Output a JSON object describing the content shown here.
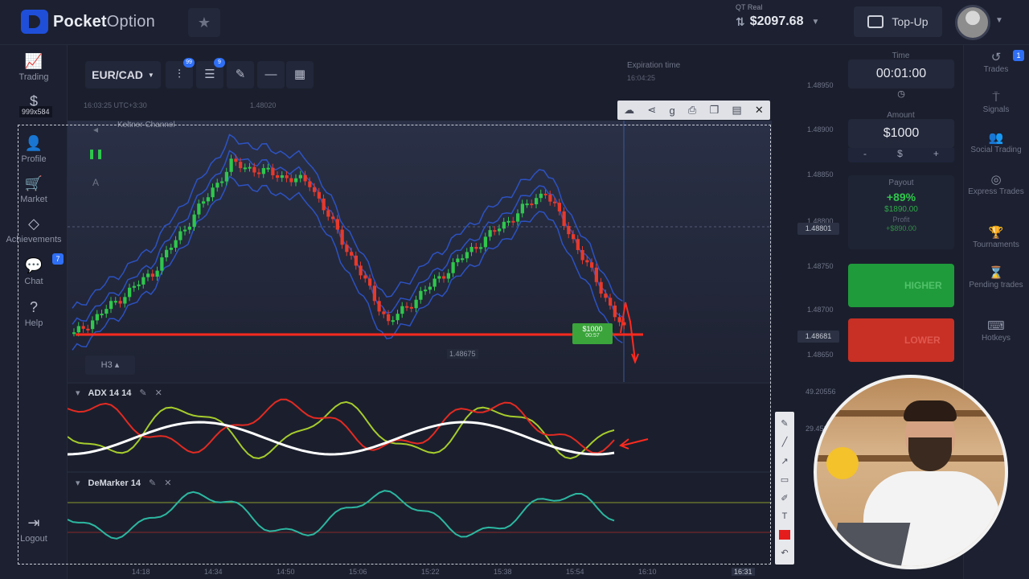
{
  "header": {
    "logo_bold": "Pocket",
    "logo_light": "Option",
    "favorite_icon": "star-icon",
    "account_type": "QT Real",
    "balance": "$2097.68",
    "topup_label": "Top-Up"
  },
  "left_nav": {
    "size_tag": "999x584",
    "items": [
      {
        "label": "Trading",
        "icon": "chart-icon"
      },
      {
        "label": "$",
        "icon": "dollar-icon"
      },
      {
        "label": "Profile",
        "icon": "user-icon"
      },
      {
        "label": "Market",
        "icon": "cart-icon"
      },
      {
        "label": "Achievements",
        "icon": "diamond-icon"
      },
      {
        "label": "Chat",
        "icon": "chat-icon",
        "badge": "7"
      },
      {
        "label": "Help",
        "icon": "help-icon"
      },
      {
        "label": "Logout",
        "icon": "logout-icon"
      }
    ]
  },
  "chart_toolbar": {
    "pair": "EUR/CAD",
    "badge_1": "99",
    "badge_2": "9",
    "time_info": "16:03:25  UTC+3:30",
    "top_price": "1.48020",
    "indicator_name": "Keltner Channel",
    "timeframe": "H3"
  },
  "expiration": {
    "label": "Expiration time",
    "value": "16:04:25"
  },
  "trade_marker": {
    "amount": "$1000",
    "timer": "00:57",
    "low_price": "1.48675"
  },
  "indicators": {
    "adx_label": "ADX 14 14",
    "demarker_label": "DeMarker 14"
  },
  "price_axis": [
    "1.48950",
    "1.48900",
    "1.48850",
    "1.48800",
    "1.48750",
    "1.48700",
    "1.48650"
  ],
  "price_tags": {
    "upper": "1.48801",
    "current": "1.48681"
  },
  "adx_axis_top": "49.20556",
  "adx_axis_mid": "29.45212",
  "time_axis": [
    "14:18",
    "14:34",
    "14:50",
    "15:06",
    "15:22",
    "15:38",
    "15:54",
    "16:10",
    "16:31"
  ],
  "trade_panel": {
    "time_label": "Time",
    "time_value": "00:01:00",
    "amount_label": "Amount",
    "amount_value": "$1000",
    "amount_minus": "-",
    "amount_currency": "$",
    "amount_plus": "+",
    "payout_label": "Payout",
    "payout_pct": "+89%",
    "payout_amount": "$1890.00",
    "profit_label": "Profit",
    "profit_amount": "+$890.00",
    "higher_label": "HIGHER",
    "lower_label": "LOWER"
  },
  "right_nav": {
    "items": [
      {
        "label": "Trades",
        "icon": "history-icon",
        "badge": "1"
      },
      {
        "label": "Signals",
        "icon": "signal-icon"
      },
      {
        "label": "Social Trading",
        "icon": "social-icon"
      },
      {
        "label": "Express Trades",
        "icon": "express-icon"
      },
      {
        "label": "Tournaments",
        "icon": "trophy-icon"
      },
      {
        "label": "Pending trades",
        "icon": "hourglass-icon"
      },
      {
        "label": "Hotkeys",
        "icon": "keyboard-icon"
      }
    ]
  },
  "colors": {
    "bull": "#2fc74c",
    "bear": "#e8392a",
    "channel": "#2e59d9",
    "adx_green": "#a6cc2c",
    "adx_red": "#e32a22",
    "adx_white": "#ffffff",
    "demarker": "#2cb7a1"
  },
  "chart_data": {
    "type": "candlestick",
    "symbol": "EUR/CAD",
    "x": [
      "14:18",
      "14:34",
      "14:50",
      "15:06",
      "15:22",
      "15:38",
      "15:54",
      "16:10"
    ],
    "close": [
      1.48685,
      1.48765,
      1.48905,
      1.4888,
      1.487,
      1.4879,
      1.4887,
      1.4869
    ],
    "ylim": [
      1.4865,
      1.4895
    ]
  }
}
